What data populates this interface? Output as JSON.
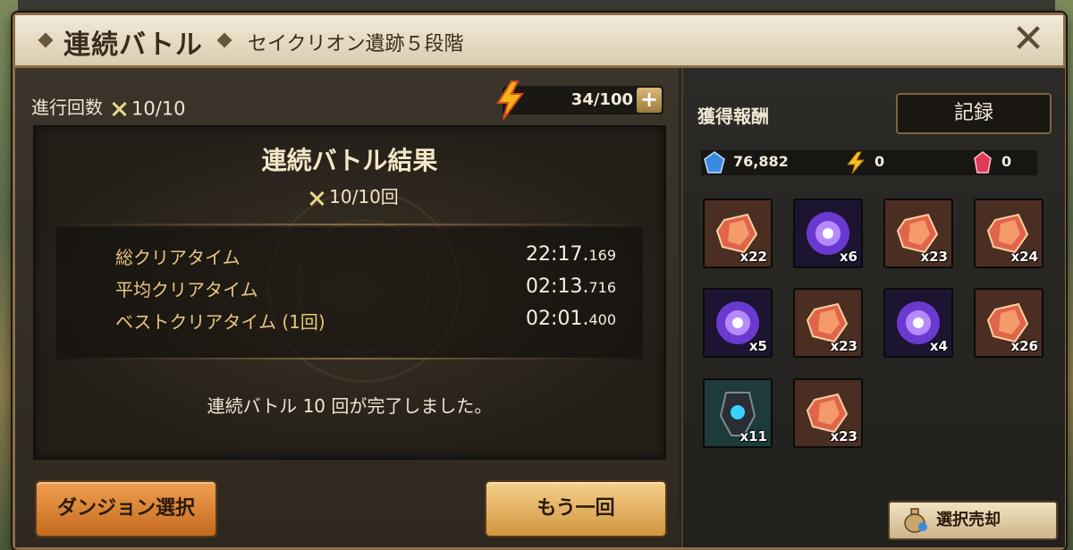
{
  "header": {
    "title": "連続バトル",
    "subtitle": "セイクリオン遺跡５段階",
    "close_icon": "close-icon"
  },
  "progress": {
    "label": "進行回数",
    "value": "10/10",
    "icon": "crossed-swords-icon"
  },
  "energy": {
    "value": "34/100",
    "plus_label": "+",
    "icon": "lightning-icon"
  },
  "result": {
    "title": "連続バトル結果",
    "count": "10/10回",
    "times": [
      {
        "label": "総クリアタイム",
        "main": "22:17.",
        "ms": "169"
      },
      {
        "label": "平均クリアタイム",
        "main": "02:13.",
        "ms": "716"
      },
      {
        "label": "ベストクリアタイム (1回)",
        "main": "02:01.",
        "ms": "400"
      }
    ],
    "message": "連続バトル 10 回が完了しました。"
  },
  "buttons": {
    "dungeon_select": "ダンジョン選択",
    "retry": "もう一回"
  },
  "rewards": {
    "label": "獲得報酬",
    "record_label": "記録",
    "currencies": [
      {
        "icon": "blue-crystal-icon",
        "value": "76,882"
      },
      {
        "icon": "lightning-icon",
        "value": "0"
      },
      {
        "icon": "red-crystal-icon",
        "value": "0"
      }
    ],
    "items": [
      {
        "type": "rune-fragment",
        "icon": "rune-fragment-icon",
        "count": "x22"
      },
      {
        "type": "magic-orb",
        "icon": "magic-orb-icon",
        "count": "x6"
      },
      {
        "type": "rune-fragment",
        "icon": "rune-fragment-icon",
        "count": "x23"
      },
      {
        "type": "rune-fragment",
        "icon": "rune-fragment-icon",
        "count": "x24"
      },
      {
        "type": "magic-orb",
        "icon": "magic-orb-icon",
        "count": "x5"
      },
      {
        "type": "rune-fragment",
        "icon": "rune-fragment-icon",
        "count": "x23"
      },
      {
        "type": "magic-orb",
        "icon": "magic-orb-icon",
        "count": "x4"
      },
      {
        "type": "rune-fragment",
        "icon": "rune-fragment-icon",
        "count": "x26"
      },
      {
        "type": "dark-relic",
        "icon": "dark-relic-icon",
        "count": "x11"
      },
      {
        "type": "rune-fragment",
        "icon": "rune-fragment-icon",
        "count": "x23"
      }
    ],
    "sell_label": "選択売却",
    "sell_icon": "money-bag-icon"
  },
  "colors": {
    "header_bg": "#e8dcc2",
    "frame_border": "#8a6e45",
    "gold_text": "#e9c680",
    "orange_button": "#e08a3a",
    "yellow_button": "#e6b766"
  }
}
